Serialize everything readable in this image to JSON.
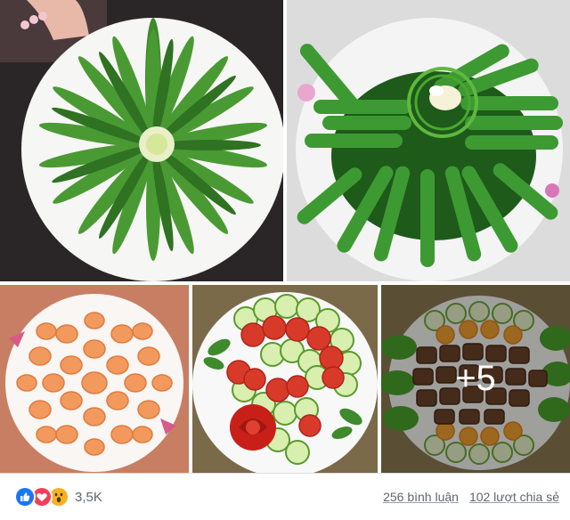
{
  "photo_grid": {
    "more_overlay": "+5",
    "tiles": [
      {
        "subject": "green beans arranged radially on white plate"
      },
      {
        "subject": "green beans with greens and garlic on white plate"
      },
      {
        "subject": "boiled shrimp arranged in circle"
      },
      {
        "subject": "cucumber and tomato slice salad"
      },
      {
        "subject": "braised pork with cucumber and carrot slices"
      }
    ]
  },
  "footer": {
    "reaction_icons": [
      "like-icon",
      "love-icon",
      "wow-icon"
    ],
    "reaction_count": "3,5K",
    "comments": "256 bình luận",
    "shares": "102 lượt chia sẻ"
  },
  "colors": {
    "like": "#1877f2",
    "love": "#f33e58",
    "wow": "#f7b125",
    "meta_text": "#606770"
  }
}
